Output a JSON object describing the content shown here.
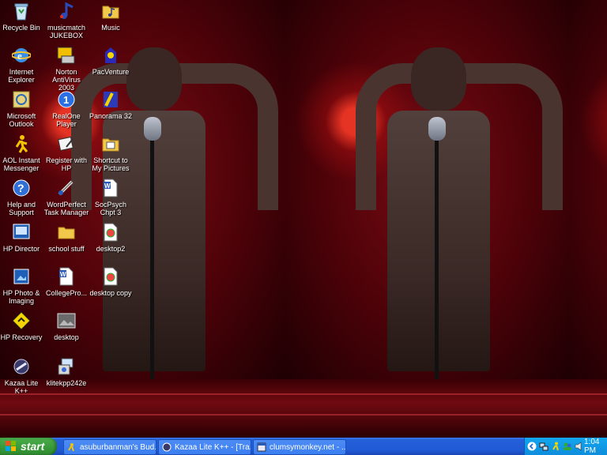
{
  "desktop_icons": [
    {
      "label": "Recycle Bin",
      "icon": "recycle-bin-icon"
    },
    {
      "label": "Internet Explorer",
      "icon": "internet-explorer-icon"
    },
    {
      "label": "Microsoft Outlook",
      "icon": "outlook-icon"
    },
    {
      "label": "AOL Instant Messenger",
      "icon": "aim-icon"
    },
    {
      "label": "Help and Support",
      "icon": "help-icon"
    },
    {
      "label": "HP Director",
      "icon": "hp-director-icon"
    },
    {
      "label": "HP Photo & Imaging",
      "icon": "hp-photo-icon"
    },
    {
      "label": "HP Recovery",
      "icon": "hp-recovery-icon"
    },
    {
      "label": "Kazaa Lite K++",
      "icon": "kazaa-icon"
    },
    {
      "label": "musicmatch JUKEBOX",
      "icon": "musicmatch-icon"
    },
    {
      "label": "Norton AntiVirus 2003",
      "icon": "norton-icon"
    },
    {
      "label": "RealOne Player",
      "icon": "realone-icon"
    },
    {
      "label": "Register with HP",
      "icon": "register-icon"
    },
    {
      "label": "WordPerfect Task Manager",
      "icon": "wordperfect-icon"
    },
    {
      "label": "school stuff",
      "icon": "folder-icon"
    },
    {
      "label": "CollegePro...",
      "icon": "word-doc-icon"
    },
    {
      "label": "desktop",
      "icon": "image-file-icon"
    },
    {
      "label": "klitekpp242e",
      "icon": "installer-icon"
    },
    {
      "label": "Music",
      "icon": "music-folder-icon"
    },
    {
      "label": "PacVenture",
      "icon": "pacventure-icon"
    },
    {
      "label": "Panorama 32",
      "icon": "panorama-icon"
    },
    {
      "label": "Shortcut to My Pictures",
      "icon": "pictures-shortcut-icon"
    },
    {
      "label": "SocPsych Chpt 3",
      "icon": "word-doc-icon"
    },
    {
      "label": "desktop2",
      "icon": "image-file-icon"
    },
    {
      "label": "desktop copy",
      "icon": "image-file-icon"
    }
  ],
  "taskbar": {
    "start_label": "start",
    "tasks": [
      {
        "label": "asuburbanman's Bud...",
        "icon": "aim-buddy-icon"
      },
      {
        "label": "Kazaa Lite K++ - [Tra...",
        "icon": "kazaa-icon"
      },
      {
        "label": "clumsymonkey.net - ...",
        "icon": "browser-icon"
      }
    ],
    "clock": "1:04 PM"
  }
}
